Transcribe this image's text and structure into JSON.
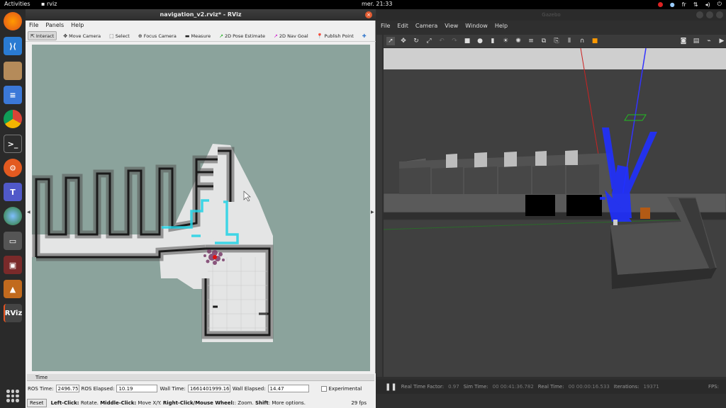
{
  "topbar": {
    "activities": "Activities",
    "app_name": "rviz",
    "clock": "mer. 21:33",
    "keyboard": "fr"
  },
  "rviz": {
    "title": "navigation_v2.rviz* - RViz",
    "menu": [
      "File",
      "Panels",
      "Help"
    ],
    "tools": [
      {
        "label": "Interact",
        "icon": "interact-icon"
      },
      {
        "label": "Move Camera",
        "icon": "move-camera-icon"
      },
      {
        "label": "Select",
        "icon": "select-icon"
      },
      {
        "label": "Focus Camera",
        "icon": "focus-camera-icon"
      },
      {
        "label": "Measure",
        "icon": "measure-icon"
      },
      {
        "label": "2D Pose Estimate",
        "icon": "pose-estimate-icon"
      },
      {
        "label": "2D Nav Goal",
        "icon": "nav-goal-icon"
      },
      {
        "label": "Publish Point",
        "icon": "publish-point-icon"
      }
    ],
    "time_panel": {
      "header": "Time",
      "ros_time_label": "ROS Time:",
      "ros_time": "2496.75",
      "ros_elapsed_label": "ROS Elapsed:",
      "ros_elapsed": "10.19",
      "wall_time_label": "Wall Time:",
      "wall_time": "1661401999.16",
      "wall_elapsed_label": "Wall Elapsed:",
      "wall_elapsed": "14.47",
      "experimental_label": "Experimental"
    },
    "status": {
      "reset_label": "Reset",
      "hint_b1": "Left-Click:",
      "hint_t1": " Rotate. ",
      "hint_b2": "Middle-Click:",
      "hint_t2": " Move X/Y. ",
      "hint_b3": "Right-Click/Mouse Wheel:",
      "hint_t3": ": Zoom. ",
      "hint_b4": "Shift",
      "hint_t4": ": More options.",
      "fps": "29 fps"
    }
  },
  "gazebo": {
    "title": "Gazebo",
    "menu": [
      "File",
      "Edit",
      "Camera",
      "View",
      "Window",
      "Help"
    ],
    "status": {
      "rtf_label": "Real Time Factor:",
      "rtf": "0.97",
      "sim_label": "Sim Time:",
      "sim": "00 00:41:36.782",
      "real_label": "Real Time:",
      "real": "00 00:00:16.533",
      "iter_label": "Iterations:",
      "iter": "19371",
      "fps_label": "FPS:"
    }
  },
  "colors": {
    "rviz_grid_bg": "#8ba39c",
    "path_cyan": "#22d3e6",
    "robot_red": "#e01010",
    "laser_blue": "#2030ff"
  }
}
